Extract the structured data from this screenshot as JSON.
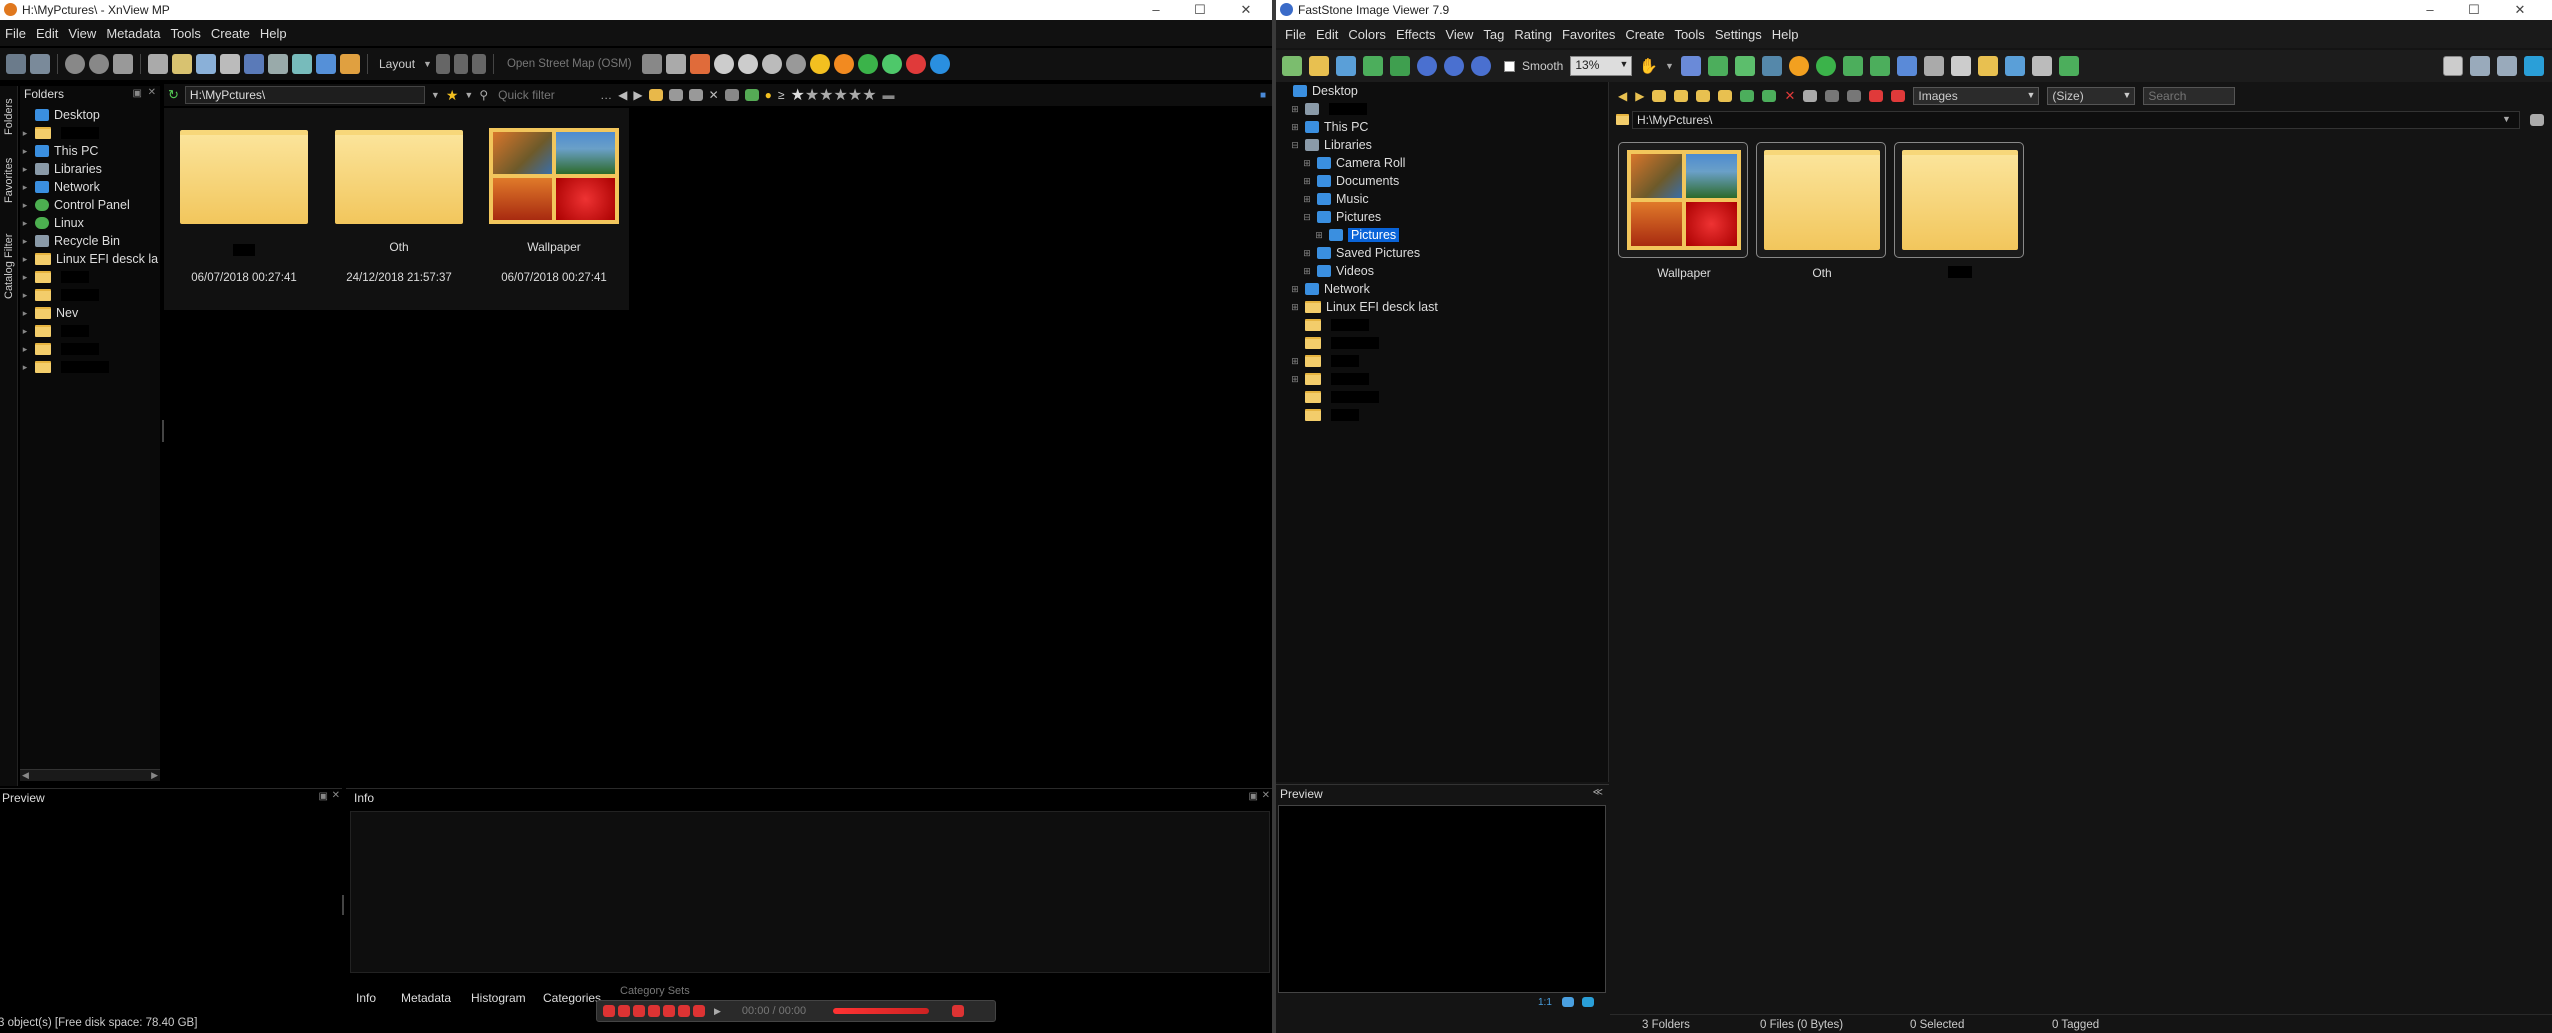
{
  "xnview": {
    "title": "H:\\MyPctures\\ - XnView MP",
    "menu": [
      "File",
      "Edit",
      "View",
      "Metadata",
      "Tools",
      "Create",
      "Help"
    ],
    "toolbar": {
      "layout_label": "Layout",
      "map_label": "Open Street Map (OSM)"
    },
    "side_tabs": [
      "Folders",
      "Favorites",
      "Catalog Filter"
    ],
    "folders_title": "Folders",
    "path": "H:\\MyPctures\\",
    "quick_filter_placeholder": "Quick filter",
    "tree": [
      {
        "label": "Desktop",
        "icon": "desktop-icon"
      },
      {
        "label": "",
        "icon": "folder-icon"
      },
      {
        "label": "This PC",
        "icon": "computer-icon"
      },
      {
        "label": "Libraries",
        "icon": "libraries-icon"
      },
      {
        "label": "Network",
        "icon": "network-icon"
      },
      {
        "label": "Control Panel",
        "icon": "control-panel-icon"
      },
      {
        "label": "Linux",
        "icon": "linux-icon"
      },
      {
        "label": "Recycle Bin",
        "icon": "recycle-bin-icon"
      },
      {
        "label": "Linux EFI desck la",
        "icon": "folder-icon"
      },
      {
        "label": "",
        "icon": "folder-icon"
      },
      {
        "label": "",
        "icon": "folder-icon"
      },
      {
        "label": "Nev",
        "icon": "folder-icon"
      },
      {
        "label": "",
        "icon": "folder-icon"
      },
      {
        "label": "",
        "icon": "folder-icon"
      },
      {
        "label": "",
        "icon": "folder-icon"
      }
    ],
    "items": [
      {
        "name": "",
        "date": "06/07/2018 00:27:41",
        "kind": "folder"
      },
      {
        "name": "Oth",
        "date": "24/12/2018 21:57:37",
        "kind": "folder"
      },
      {
        "name": "Wallpaper",
        "date": "06/07/2018 00:27:41",
        "kind": "wallpaper"
      }
    ],
    "preview_title": "Preview",
    "info_title": "Info",
    "info_tabs": [
      "Info",
      "Metadata",
      "Histogram",
      "Categories",
      "Category Sets"
    ],
    "player_time": "00:00 / 00:00",
    "status": "3 object(s) [Free disk space: 78.40 GB]"
  },
  "faststone": {
    "title": "FastStone Image Viewer 7.9",
    "menu": [
      "File",
      "Edit",
      "Colors",
      "Effects",
      "View",
      "Tag",
      "Rating",
      "Favorites",
      "Create",
      "Tools",
      "Settings",
      "Help"
    ],
    "smooth_label": "Smooth",
    "zoom": "13%",
    "filter": "Images",
    "sort": "(Size)",
    "search_placeholder": "Search",
    "path": "H:\\MyPctures\\",
    "tree": [
      {
        "label": "Desktop",
        "icon": "desktop-icon",
        "indent": 0,
        "exp": ""
      },
      {
        "label": "",
        "icon": "user-icon",
        "indent": 1,
        "exp": "+"
      },
      {
        "label": "This PC",
        "icon": "computer-icon",
        "indent": 1,
        "exp": "+"
      },
      {
        "label": "Libraries",
        "icon": "libraries-icon",
        "indent": 1,
        "exp": "-"
      },
      {
        "label": "Camera Roll",
        "icon": "library-icon",
        "indent": 2,
        "exp": "+"
      },
      {
        "label": "Documents",
        "icon": "library-icon",
        "indent": 2,
        "exp": "+"
      },
      {
        "label": "Music",
        "icon": "library-icon",
        "indent": 2,
        "exp": "+"
      },
      {
        "label": "Pictures",
        "icon": "library-icon",
        "indent": 2,
        "exp": "-"
      },
      {
        "label": "Pictures",
        "icon": "library-icon",
        "indent": 3,
        "exp": "+",
        "selected": true
      },
      {
        "label": "Saved Pictures",
        "icon": "library-icon",
        "indent": 2,
        "exp": "+"
      },
      {
        "label": "Videos",
        "icon": "library-icon",
        "indent": 2,
        "exp": "+"
      },
      {
        "label": "Network",
        "icon": "network-icon",
        "indent": 1,
        "exp": "+"
      },
      {
        "label": "Linux EFI desck last",
        "icon": "folder-icon",
        "indent": 1,
        "exp": "+"
      },
      {
        "label": "",
        "icon": "folder-icon",
        "indent": 1,
        "exp": ""
      },
      {
        "label": "",
        "icon": "folder-icon",
        "indent": 1,
        "exp": ""
      },
      {
        "label": "",
        "icon": "folder-icon",
        "indent": 1,
        "exp": "+"
      },
      {
        "label": "",
        "icon": "folder-icon",
        "indent": 1,
        "exp": "+"
      },
      {
        "label": "",
        "icon": "folder-icon",
        "indent": 1,
        "exp": ""
      },
      {
        "label": "",
        "icon": "folder-icon",
        "indent": 1,
        "exp": ""
      }
    ],
    "items": [
      {
        "name": "Wallpaper",
        "kind": "wallpaper"
      },
      {
        "name": "Oth",
        "kind": "folder"
      },
      {
        "name": "",
        "kind": "folder"
      }
    ],
    "preview_title": "Preview",
    "zoom_ratio": "1:1",
    "status": {
      "folders": "3 Folders",
      "files": "0 Files (0 Bytes)",
      "selected": "0 Selected",
      "tagged": "0 Tagged"
    }
  },
  "colors": {
    "selection": "#0a64d8",
    "folder": "#f2c65c",
    "xn_bg": "#000000",
    "fs_bg": "#141414"
  }
}
